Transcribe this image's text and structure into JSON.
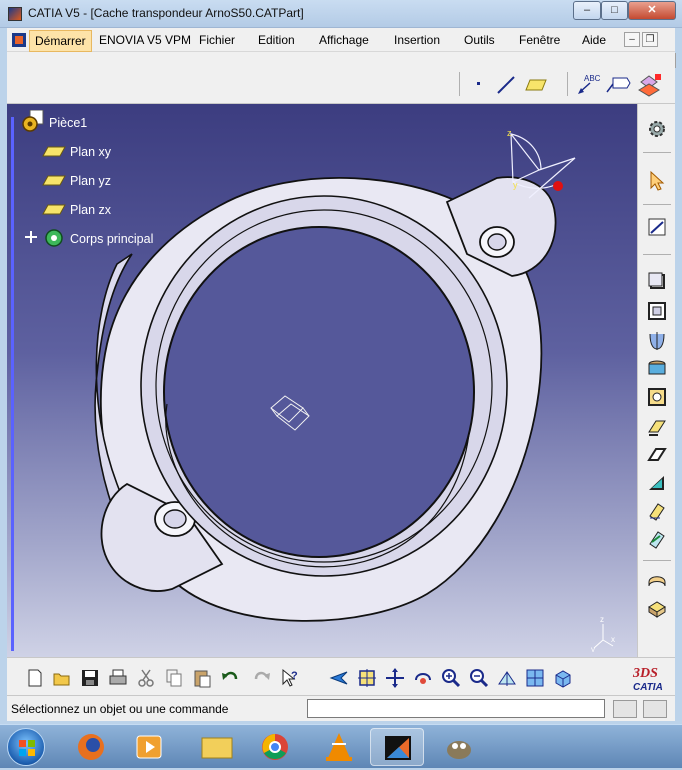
{
  "window": {
    "title": "CATIA V5 - [Cache transpondeur ArnoS50.CATPart]"
  },
  "window_buttons": [
    "–",
    "□",
    "✕"
  ],
  "menu": {
    "items": [
      "Démarrer",
      "ENOVIA V5 VPM",
      "Fichier",
      "Edition",
      "Affichage",
      "Insertion",
      "Outils",
      "Fenêtre",
      "Aide"
    ],
    "mdi_buttons": [
      "–",
      "❐",
      "✕"
    ]
  },
  "tree": {
    "root": "Pièce1",
    "items": [
      "Plan xy",
      "Plan yz",
      "Plan zx",
      "Corps principal"
    ]
  },
  "compass": {
    "z": "z",
    "y": "y",
    "x": "x"
  },
  "status": {
    "message": "Sélectionnez un objet ou une commande",
    "input_value": ""
  },
  "brand": {
    "logo_text": "CATIA"
  },
  "colors": {
    "viewport_top": "#3c3d80",
    "viewport_bottom": "#cfd2e6",
    "tree_rail": "#5a62ff",
    "menu_highlight": "#fde3a8"
  },
  "toolbar_icons": [
    "new-file-icon",
    "open-folder-icon",
    "save-icon",
    "print-icon",
    "cut-icon",
    "copy-icon",
    "paste-icon",
    "undo-icon",
    "redo-icon",
    "whats-this-icon",
    "fly-mode-icon",
    "fit-all-icon",
    "pan-icon",
    "rotate-icon",
    "zoom-in-icon",
    "zoom-out-icon",
    "normal-view-icon",
    "multi-view-icon",
    "iso-view-icon"
  ],
  "right_toolbar_icons": [
    "settings-icon",
    "select-arrow-icon",
    "sketch-icon",
    "pad-icon",
    "pocket-icon",
    "shaft-icon",
    "groove-icon",
    "hole-icon",
    "rib-icon",
    "slot-icon",
    "stiffener-icon",
    "multi-section-icon",
    "removed-multi-section-icon",
    "split-icon",
    "thick-surface-icon",
    "draft-icon",
    "shell-icon"
  ],
  "top_toolbar_icons": [
    "point-icon",
    "line-icon",
    "plane-icon",
    "text-annotation-icon",
    "flag-note-icon",
    "apply-material-icon"
  ]
}
